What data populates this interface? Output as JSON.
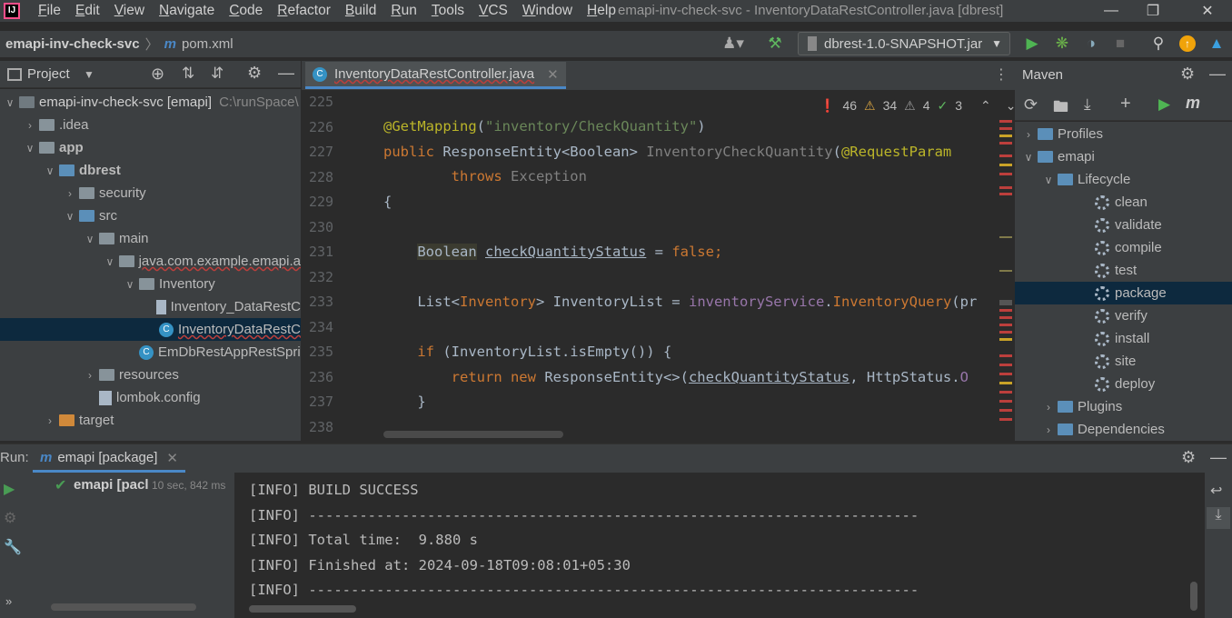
{
  "window": {
    "title": "emapi-inv-check-svc - InventoryDataRestController.java [dbrest]",
    "menu": [
      {
        "label": "File",
        "u": "F",
        "rest": "ile"
      },
      {
        "label": "Edit",
        "u": "E",
        "rest": "dit"
      },
      {
        "label": "View",
        "u": "V",
        "rest": "iew"
      },
      {
        "label": "Navigate",
        "u": "N",
        "rest": "avigate"
      },
      {
        "label": "Code",
        "u": "C",
        "rest": "ode"
      },
      {
        "label": "Refactor",
        "u": "R",
        "rest": "efactor"
      },
      {
        "label": "Build",
        "u": "B",
        "rest": "uild"
      },
      {
        "label": "Run",
        "u": "R",
        "rest": "un"
      },
      {
        "label": "Tools",
        "u": "T",
        "rest": "ools"
      },
      {
        "label": "VCS",
        "u": "V",
        "rest": "CS"
      },
      {
        "label": "Window",
        "u": "W",
        "rest": "indow"
      },
      {
        "label": "Help",
        "u": "H",
        "rest": "elp"
      }
    ]
  },
  "breadcrumb": {
    "project": "emapi-inv-check-svc",
    "file": "pom.xml"
  },
  "run_config": {
    "label": "dbrest-1.0-SNAPSHOT.jar"
  },
  "project_panel": {
    "title": "Project",
    "rows": [
      {
        "label": "emapi-inv-check-svc [emapi]",
        "extra": "C:\\runSpace\\",
        "depth": 0,
        "arrow": "v",
        "icon": "dark"
      },
      {
        "label": ".idea",
        "depth": 1,
        "arrow": ">",
        "icon": "folder"
      },
      {
        "label": "app",
        "depth": 1,
        "arrow": "v",
        "icon": "folder"
      },
      {
        "label": "dbrest",
        "depth": 2,
        "arrow": "v",
        "icon": "blue"
      },
      {
        "label": "security",
        "depth": 3,
        "arrow": ">",
        "icon": "folder"
      },
      {
        "label": "src",
        "depth": 3,
        "arrow": "v",
        "icon": "blue"
      },
      {
        "label": "main",
        "depth": 4,
        "arrow": "v",
        "icon": "folder"
      },
      {
        "label": "java.com.example.emapi.a",
        "depth": 5,
        "arrow": "v",
        "icon": "folder"
      },
      {
        "label": "Inventory",
        "depth": 6,
        "arrow": "v",
        "icon": "folder"
      },
      {
        "label": "Inventory_DataRestC",
        "depth": 7,
        "arrow": "",
        "icon": "file"
      },
      {
        "label": "InventoryDataRestC",
        "depth": 7,
        "arrow": "",
        "icon": "class"
      },
      {
        "label": "EmDbRestAppRestSpri",
        "depth": 6,
        "arrow": "",
        "icon": "class"
      },
      {
        "label": "resources",
        "depth": 4,
        "arrow": ">",
        "icon": "folder"
      },
      {
        "label": "lombok.config",
        "depth": 4,
        "arrow": "",
        "icon": "file"
      },
      {
        "label": "target",
        "depth": 2,
        "arrow": ">",
        "icon": "orange"
      }
    ]
  },
  "editor": {
    "tab": "InventoryDataRestController.java",
    "inspections": {
      "errors": "46",
      "warnings": "34",
      "weak": "4",
      "ok": "3"
    },
    "line_numbers": [
      "225",
      "226",
      "227",
      "228",
      "229",
      "230",
      "231",
      "232",
      "233",
      "234",
      "235",
      "236",
      "237",
      "238"
    ]
  },
  "maven": {
    "title": "Maven",
    "rows": [
      {
        "label": "Profiles",
        "depth": 0,
        "arrow": ">",
        "icon": "folder"
      },
      {
        "label": "emapi",
        "depth": 0,
        "arrow": "v",
        "icon": "folder"
      },
      {
        "label": "Lifecycle",
        "depth": 1,
        "arrow": "v",
        "icon": "folder"
      },
      {
        "label": "clean",
        "depth": 2,
        "icon": "gear"
      },
      {
        "label": "validate",
        "depth": 2,
        "icon": "gear"
      },
      {
        "label": "compile",
        "depth": 2,
        "icon": "gear"
      },
      {
        "label": "test",
        "depth": 2,
        "icon": "gear"
      },
      {
        "label": "package",
        "depth": 2,
        "icon": "gear",
        "selected": true
      },
      {
        "label": "verify",
        "depth": 2,
        "icon": "gear"
      },
      {
        "label": "install",
        "depth": 2,
        "icon": "gear"
      },
      {
        "label": "site",
        "depth": 2,
        "icon": "gear"
      },
      {
        "label": "deploy",
        "depth": 2,
        "icon": "gear"
      },
      {
        "label": "Plugins",
        "depth": 1,
        "arrow": ">",
        "icon": "folder"
      },
      {
        "label": "Dependencies",
        "depth": 1,
        "arrow": ">",
        "icon": "folder"
      }
    ]
  },
  "run": {
    "label": "Run:",
    "tab": "emapi [package]",
    "tree_item": "emapi [pacl",
    "tree_time": "10 sec, 842 ms",
    "console": [
      "[INFO] BUILD SUCCESS",
      "[INFO] ------------------------------------------------------------------------",
      "[INFO] Total time:  9.880 s",
      "[INFO] Finished at: 2024-09-18T09:08:01+05:30",
      "[INFO] ------------------------------------------------------------------------"
    ]
  }
}
